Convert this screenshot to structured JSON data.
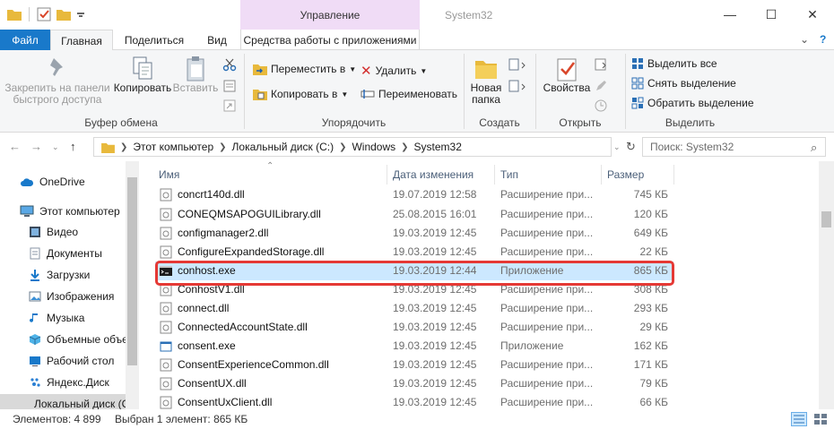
{
  "titlebar": {
    "context_group": "Управление",
    "window_title": "System32",
    "minimize": "—",
    "maximize": "☐",
    "close": "✕"
  },
  "tabs": {
    "file": "Файл",
    "home": "Главная",
    "share": "Поделиться",
    "view": "Вид",
    "app_tools": "Средства работы с приложениями",
    "collapse": "⌄",
    "help": "?"
  },
  "ribbon": {
    "pin_label": "Закрепить на панели быстрого доступа",
    "copy_label": "Копировать",
    "paste_label": "Вставить",
    "clipboard_group": "Буфер обмена",
    "move_to": "Переместить в",
    "copy_to": "Копировать в",
    "delete": "Удалить",
    "rename": "Переименовать",
    "organize_group": "Упорядочить",
    "new_folder": "Новая папка",
    "create_group": "Создать",
    "properties": "Свойства",
    "open_group": "Открыть",
    "select_all": "Выделить все",
    "select_none": "Снять выделение",
    "invert_selection": "Обратить выделение",
    "select_group": "Выделить"
  },
  "address": {
    "crumbs": [
      "Этот компьютер",
      "Локальный диск (C:)",
      "Windows",
      "System32"
    ],
    "search_placeholder": "Поиск: System32"
  },
  "nav": {
    "items": [
      {
        "label": "OneDrive",
        "icon": "cloud-icon"
      },
      {
        "label": "Этот компьютер",
        "icon": "computer-icon"
      },
      {
        "label": "Видео",
        "icon": "video-icon"
      },
      {
        "label": "Документы",
        "icon": "documents-icon"
      },
      {
        "label": "Загрузки",
        "icon": "downloads-icon"
      },
      {
        "label": "Изображения",
        "icon": "pictures-icon"
      },
      {
        "label": "Музыка",
        "icon": "music-icon"
      },
      {
        "label": "Объемные объекты",
        "icon": "3d-objects-icon"
      },
      {
        "label": "Рабочий стол",
        "icon": "desktop-icon"
      },
      {
        "label": "Яндекс.Диск",
        "icon": "yandex-disk-icon"
      },
      {
        "label": "Локальный диск (C:)",
        "icon": "drive-icon"
      }
    ]
  },
  "list": {
    "columns": {
      "name": "Имя",
      "date": "Дата изменения",
      "type": "Тип",
      "size": "Размер"
    },
    "rows": [
      {
        "name": "concrt140d.dll",
        "date": "19.07.2019 12:58",
        "type": "Расширение при...",
        "size": "745 КБ",
        "icon": "dll-icon"
      },
      {
        "name": "CONEQMSAPOGUILibrary.dll",
        "date": "25.08.2015 16:01",
        "type": "Расширение при...",
        "size": "120 КБ",
        "icon": "dll-icon"
      },
      {
        "name": "configmanager2.dll",
        "date": "19.03.2019 12:45",
        "type": "Расширение при...",
        "size": "649 КБ",
        "icon": "dll-icon"
      },
      {
        "name": "ConfigureExpandedStorage.dll",
        "date": "19.03.2019 12:45",
        "type": "Расширение при...",
        "size": "22 КБ",
        "icon": "dll-icon"
      },
      {
        "name": "conhost.exe",
        "date": "19.03.2019 12:44",
        "type": "Приложение",
        "size": "865 КБ",
        "icon": "console-icon",
        "selected": true
      },
      {
        "name": "ConhostV1.dll",
        "date": "19.03.2019 12:45",
        "type": "Расширение при...",
        "size": "308 КБ",
        "icon": "dll-icon"
      },
      {
        "name": "connect.dll",
        "date": "19.03.2019 12:45",
        "type": "Расширение при...",
        "size": "293 КБ",
        "icon": "dll-icon"
      },
      {
        "name": "ConnectedAccountState.dll",
        "date": "19.03.2019 12:45",
        "type": "Расширение при...",
        "size": "29 КБ",
        "icon": "dll-icon"
      },
      {
        "name": "consent.exe",
        "date": "19.03.2019 12:45",
        "type": "Приложение",
        "size": "162 КБ",
        "icon": "exe-icon"
      },
      {
        "name": "ConsentExperienceCommon.dll",
        "date": "19.03.2019 12:45",
        "type": "Расширение при...",
        "size": "171 КБ",
        "icon": "dll-icon"
      },
      {
        "name": "ConsentUX.dll",
        "date": "19.03.2019 12:45",
        "type": "Расширение при...",
        "size": "79 КБ",
        "icon": "dll-icon"
      },
      {
        "name": "ConsentUxClient.dll",
        "date": "19.03.2019 12:45",
        "type": "Расширение при...",
        "size": "66 КБ",
        "icon": "dll-icon"
      }
    ]
  },
  "status": {
    "count": "Элементов: 4 899",
    "selection": "Выбран 1 элемент: 865 КБ"
  },
  "colors": {
    "accent": "#1979ca",
    "context_tab": "#f0dcf6",
    "selection": "#cce8ff",
    "highlight": "#e53935"
  }
}
